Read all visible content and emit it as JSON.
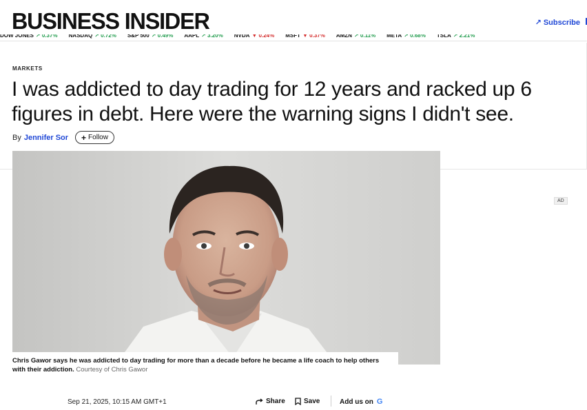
{
  "header": {
    "logo": "BUSINESS INSIDER",
    "subscribe_label": "Subscribe",
    "subscribe_icon": "arrow-up-right-icon",
    "accent_color": "#1f47d6"
  },
  "ticker": [
    {
      "symbol": "DOW JONES",
      "change": "0.37%",
      "direction": "up"
    },
    {
      "symbol": "NASDAQ",
      "change": "0.72%",
      "direction": "up"
    },
    {
      "symbol": "S&P 500",
      "change": "0.49%",
      "direction": "up"
    },
    {
      "symbol": "AAPL",
      "change": "3.20%",
      "direction": "up"
    },
    {
      "symbol": "NVDA",
      "change": "0.24%",
      "direction": "down"
    },
    {
      "symbol": "MSFT",
      "change": "0.37%",
      "direction": "down"
    },
    {
      "symbol": "AMZN",
      "change": "0.11%",
      "direction": "up"
    },
    {
      "symbol": "META",
      "change": "0.68%",
      "direction": "up"
    },
    {
      "symbol": "TSLA",
      "change": "2.21%",
      "direction": "up"
    }
  ],
  "article": {
    "section": "MARKETS",
    "headline": "I was addicted to day trading for 12 years and racked up 6 figures in debt. Here were the warning signs I didn't see.",
    "by_label": "By",
    "author": "Jennifer Sor",
    "follow_label": "Follow",
    "caption": "Chris Gawor says he was addicted to day trading for more than a decade before he became a life coach to help others with their addiction.",
    "credit": "Courtesy of Chris Gawor",
    "date": "Sep 21, 2025, 10:15 AM GMT+1",
    "share_label": "Share",
    "save_label": "Save",
    "addus_label": "Add us on",
    "addus_icon": "google-g-icon"
  },
  "ad": {
    "badge": "AD"
  }
}
